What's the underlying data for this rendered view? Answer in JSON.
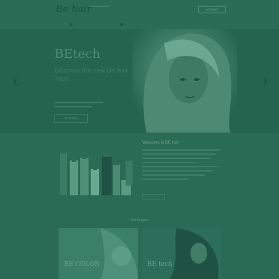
{
  "header": {
    "logo_text": "Be hair",
    "tagline": "hair care professional",
    "account_link": "ACCOUNT"
  },
  "hero": {
    "title": "BEtech",
    "subtitle": "Discover the new Be hair Tech",
    "cta": "DISCOVER",
    "prev_icon": "chevron-left-icon",
    "next_icon": "chevron-right-icon"
  },
  "welcome": {
    "title": "Welcome in BE hair"
  },
  "brands": {
    "title": "Our Brands",
    "cards": [
      {
        "label": "BE COLOR"
      },
      {
        "label": "BE tech"
      }
    ]
  },
  "colors": {
    "background": "#2a6b55",
    "hero": "#25644f",
    "text_muted": "#4f8e77"
  }
}
